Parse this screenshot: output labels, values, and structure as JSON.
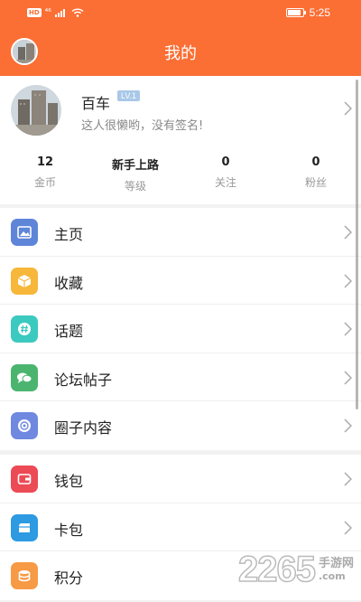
{
  "status_bar": {
    "hd": "HD",
    "network": "⁴⁶",
    "time": "5:25"
  },
  "title_bar": {
    "title": "我的"
  },
  "profile": {
    "username": "百车",
    "level": "LV.1",
    "signature": "这人很懒哟，没有签名!"
  },
  "stats": [
    {
      "value": "12",
      "label": "金币"
    },
    {
      "value": "新手上路",
      "label": "等级"
    },
    {
      "value": "0",
      "label": "关注"
    },
    {
      "value": "0",
      "label": "粉丝"
    }
  ],
  "menu_group_1": [
    {
      "label": "主页",
      "icon": "image-icon",
      "color": "#5e85d8"
    },
    {
      "label": "收藏",
      "icon": "box-icon",
      "color": "#f7b73a"
    },
    {
      "label": "话题",
      "icon": "hashtag-icon",
      "color": "#3cc9c0"
    },
    {
      "label": "论坛帖子",
      "icon": "chat-bubbles-icon",
      "color": "#4bb56f"
    },
    {
      "label": "圈子内容",
      "icon": "circle-icon",
      "color": "#6f88e0"
    }
  ],
  "menu_group_2": [
    {
      "label": "钱包",
      "icon": "wallet-icon",
      "color": "#ec4a55"
    },
    {
      "label": "卡包",
      "icon": "card-icon",
      "color": "#2d9ae2"
    },
    {
      "label": "积分",
      "icon": "coins-icon",
      "color": "#f79a45"
    }
  ],
  "watermark": {
    "number": "2265",
    "dot_com": ".com",
    "text": "手游网"
  },
  "colors": {
    "brand": "#fb6e34"
  }
}
